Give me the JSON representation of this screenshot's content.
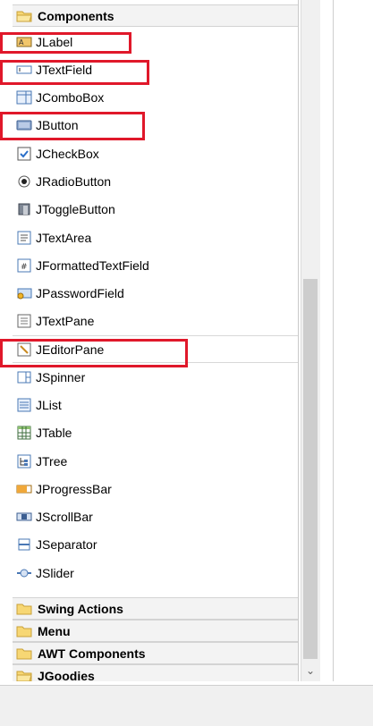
{
  "categories": {
    "components": "Components",
    "swing_actions": "Swing Actions",
    "menu": "Menu",
    "awt_components": "AWT Components",
    "jgoodies": "JGoodies"
  },
  "items": [
    {
      "label": "JLabel",
      "icon": "jlabel-icon"
    },
    {
      "label": "JTextField",
      "icon": "jtextfield-icon"
    },
    {
      "label": "JComboBox",
      "icon": "jcombobox-icon"
    },
    {
      "label": "JButton",
      "icon": "jbutton-icon"
    },
    {
      "label": "JCheckBox",
      "icon": "jcheckbox-icon"
    },
    {
      "label": "JRadioButton",
      "icon": "jradiobutton-icon"
    },
    {
      "label": "JToggleButton",
      "icon": "jtogglebutton-icon"
    },
    {
      "label": "JTextArea",
      "icon": "jtextarea-icon"
    },
    {
      "label": "JFormattedTextField",
      "icon": "jformattedtextfield-icon"
    },
    {
      "label": "JPasswordField",
      "icon": "jpasswordfield-icon"
    },
    {
      "label": "JTextPane",
      "icon": "jtextpane-icon"
    },
    {
      "label": "JEditorPane",
      "icon": "jeditorpane-icon"
    },
    {
      "label": "JSpinner",
      "icon": "jspinner-icon"
    },
    {
      "label": "JList",
      "icon": "jlist-icon"
    },
    {
      "label": "JTable",
      "icon": "jtable-icon"
    },
    {
      "label": "JTree",
      "icon": "jtree-icon"
    },
    {
      "label": "JProgressBar",
      "icon": "jprogressbar-icon"
    },
    {
      "label": "JScrollBar",
      "icon": "jscrollbar-icon"
    },
    {
      "label": "JSeparator",
      "icon": "jseparator-icon"
    },
    {
      "label": "JSlider",
      "icon": "jslider-icon"
    }
  ],
  "highlight_color": "#e0182a"
}
